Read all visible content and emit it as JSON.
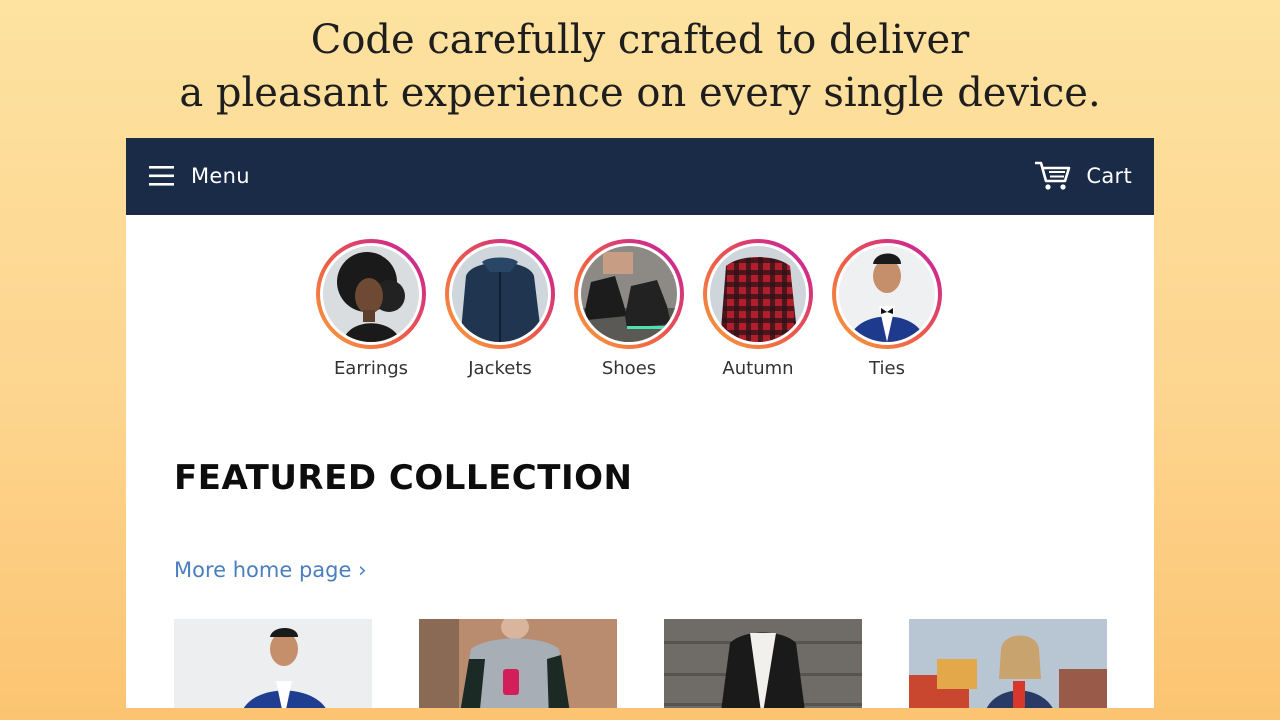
{
  "headline": {
    "line1": "Code carefully crafted to deliver",
    "line2": "a pleasant experience on every single device."
  },
  "navbar": {
    "menu_label": "Menu",
    "menu_icon": "hamburger-icon",
    "cart_label": "Cart",
    "cart_icon": "cart-icon",
    "background": "#1a2b47"
  },
  "stories": [
    {
      "label": "Earrings"
    },
    {
      "label": "Jackets"
    },
    {
      "label": "Shoes"
    },
    {
      "label": "Autumn"
    },
    {
      "label": "Ties"
    }
  ],
  "featured": {
    "title": "FEATURED COLLECTION",
    "more_link": "More home page ›"
  },
  "colors": {
    "ring_gradient": [
      "#f7a33c",
      "#ee5d47",
      "#d22f83",
      "#c02cae"
    ],
    "link": "#4a7ebf"
  }
}
